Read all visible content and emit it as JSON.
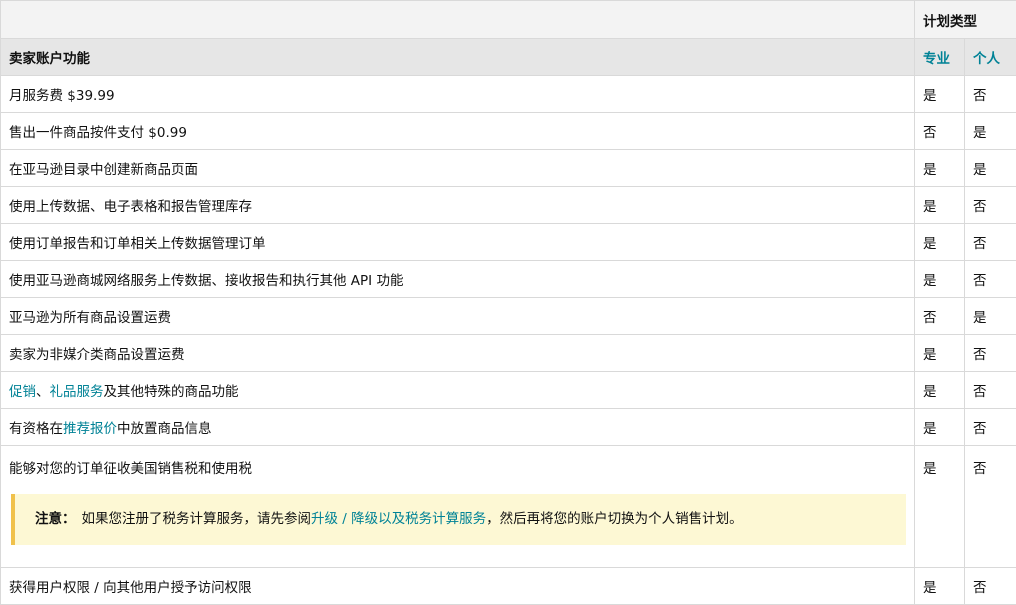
{
  "header": {
    "plan_type": "计划类型",
    "features": "卖家账户功能",
    "pro": "专业",
    "individual": "个人"
  },
  "rows": [
    {
      "pro": "是",
      "individual": "否",
      "text": "月服务费 $39.99"
    },
    {
      "pro": "否",
      "individual": "是",
      "text": "售出一件商品按件支付 $0.99"
    },
    {
      "pro": "是",
      "individual": "是",
      "text": "在亚马逊目录中创建新商品页面"
    },
    {
      "pro": "是",
      "individual": "否",
      "text": "使用上传数据、电子表格和报告管理库存"
    },
    {
      "pro": "是",
      "individual": "否",
      "text": "使用订单报告和订单相关上传数据管理订单"
    },
    {
      "pro": "是",
      "individual": "否",
      "text": "使用亚马逊商城网络服务上传数据、接收报告和执行其他 API 功能"
    },
    {
      "pro": "否",
      "individual": "是",
      "text": "亚马逊为所有商品设置运费"
    },
    {
      "pro": "是",
      "individual": "否",
      "text": "卖家为非媒介类商品设置运费"
    },
    {
      "pro": "是",
      "individual": "否",
      "link1": "促销",
      "sep": "、",
      "link2": "礼品服务",
      "rest": "及其他特殊的商品功能"
    },
    {
      "pro": "是",
      "individual": "否",
      "before": "有资格在",
      "link": "推荐报价",
      "after": "中放置商品信息"
    },
    {
      "pro": "是",
      "individual": "否",
      "text": "能够对您的订单征收美国销售税和使用税",
      "note": {
        "label": "注意：",
        "before": "如果您注册了税务计算服务，请先参阅",
        "link": "升级 / 降级以及税务计算服务",
        "after": "，然后再将您的账户切换为个人销售计划。"
      }
    },
    {
      "pro": "是",
      "individual": "否",
      "text": "获得用户权限 / 向其他用户授予访问权限"
    }
  ],
  "colors": {
    "link": "#008296",
    "note_bg": "#fdf8d4",
    "note_border": "#f0c14b",
    "header_bg": "#e6e6e6"
  }
}
